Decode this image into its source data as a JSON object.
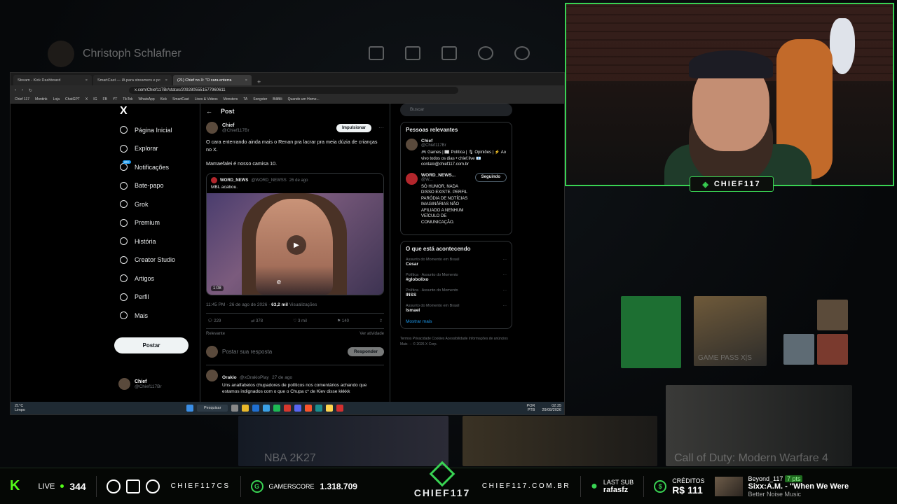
{
  "background": {
    "profile_name": "Christoph Schlafner",
    "tiles": [
      {
        "label": "NBA 2K27"
      },
      {
        "label": "Call of Duty: Modern Warfare 4"
      }
    ],
    "gamepass_label": "GAME PASS X|S"
  },
  "browser": {
    "tabs": [
      {
        "label": "Stream - Kick Dashboard"
      },
      {
        "label": "SmartCast — IA para streamers e pc"
      },
      {
        "label": "(21) Chief no X: \"O cara enterra"
      }
    ],
    "url": "x.com/Chief117Br/status/2092805551577960611",
    "bookmarks": [
      "Chief 117",
      "Montink",
      "Loja",
      "ChatGPT",
      "X",
      "IG",
      "FB",
      "YT",
      "TikTok",
      "WhatsApp",
      "Kick",
      "SmartCast",
      "Lives & Videos",
      "Monsters",
      "TA",
      "Songster",
      "BiliBili",
      "Quando um Home..."
    ]
  },
  "x": {
    "logo": "X",
    "nav": [
      {
        "label": "Página Inicial",
        "icon": "home-icon"
      },
      {
        "label": "Explorar",
        "icon": "search-icon"
      },
      {
        "label": "Notificações",
        "icon": "bell-icon",
        "badge": "20+"
      },
      {
        "label": "Bate-papo",
        "icon": "chat-icon"
      },
      {
        "label": "Grok",
        "icon": "grok-icon"
      },
      {
        "label": "Premium",
        "icon": "premium-icon"
      },
      {
        "label": "História",
        "icon": "history-icon"
      },
      {
        "label": "Creator Studio",
        "icon": "studio-icon"
      },
      {
        "label": "Artigos",
        "icon": "articles-icon"
      },
      {
        "label": "Perfil",
        "icon": "profile-icon"
      },
      {
        "label": "Mais",
        "icon": "more-icon"
      }
    ],
    "post_button": "Postar",
    "account": {
      "name": "Chief",
      "handle": "@Chief117Br"
    },
    "header": "Post",
    "post": {
      "author": "Chief",
      "handle": "@Chief117Br",
      "boost": "Impulsionar",
      "text1": "O cara enterrando ainda mais o Renan pra lacrar pra meia dúzia de crianças no X.",
      "text2": "Mamaefalei é nosso camisa 10.",
      "quote": {
        "author": "WORD_NEWS",
        "handle": "@WORD_NEWSS",
        "time": "26 de ago",
        "text": "MBL acabou.",
        "duration": "1:08",
        "caption": "e"
      },
      "meta": "11:45 PM · 26 de ago de 2026 · ",
      "views": "63,2 mil",
      "views_label": " Visualizações",
      "stats": {
        "replies": "229",
        "reposts": "378",
        "likes": "3 mil",
        "bookmarks": "140"
      },
      "sort": "Relevante",
      "activity": "Ver atividade"
    },
    "reply": {
      "placeholder": "Postar sua resposta",
      "button": "Responder"
    },
    "comment": {
      "author": "Orakio",
      "handle": "@xOrakioPlay",
      "time": "27 de ago",
      "text": "Uns analfabetos chupadores de políticos nos comentários achando que estamos indignados com o que o Chupa c* de Kiev disse kkkkk"
    },
    "search_placeholder": "Buscar",
    "relevant": {
      "title": "Pessoas relevantes",
      "people": [
        {
          "name": "Chief",
          "handle": "@Chief117Br",
          "bio": "🎮 Games | 📰 Política | 🎙 Opiniões | ⚡ Ao vivo todos os dias • chief.live 📧 contato@chief117.com.br",
          "button": ""
        },
        {
          "name": "WORD_NEWS...",
          "handle": "@W...",
          "bio": "SÓ HUMOR, NADA DISSO EXISTE. PERFIL PARÓDIA DE NOTÍCIAS IMAGINÁRIAS NÃO AFILIADO A NENHUM VEÍCULO DE COMUNICAÇÃO.",
          "button": "Seguindo"
        }
      ]
    },
    "trending": {
      "title": "O que está acontecendo",
      "items": [
        {
          "category": "Assunto do Momento em Brasil",
          "name": "Cesar"
        },
        {
          "category": "Política · Assunto do Momento",
          "name": "#globolixo"
        },
        {
          "category": "Política · Assunto do Momento",
          "name": "INSS"
        },
        {
          "category": "Assunto do Momento em Brasil",
          "name": "Ismael"
        }
      ],
      "more": "Mostrar mais"
    },
    "footer": "Termos   Privacidade   Cookies   Acessibilidade   Informações de anúncios   Mais ···   © 2026 X Corp."
  },
  "taskbar": {
    "temp": "21°C",
    "weather": "Limpo",
    "search": "Pesquisar",
    "lang": "POR PTB",
    "time": "02:35",
    "date": "29/08/2026"
  },
  "overlay": {
    "live_label": "LIVE",
    "viewers": "344",
    "channel": "CHIEF117CS",
    "gamerscore_label": "GAMERSCORE",
    "gamerscore": "1.318.709",
    "brand": "CHIEF117",
    "site": "CHIEF117.COM.BR",
    "last_sub_label": "LAST SUB",
    "last_sub": "rafasfz",
    "credits_label": "CRÉDITOS",
    "credits": "R$ 111",
    "chat_user": "Beyond_117",
    "chat_pts": "7 pts",
    "song": "Sixx:A.M. - \"When We Were",
    "label": "Better Noise Music",
    "cam_badge": "CHIEF117"
  },
  "colors": {
    "accent": "#39d353",
    "kick": "#53fc18",
    "x_blue": "#1d9bf0"
  }
}
